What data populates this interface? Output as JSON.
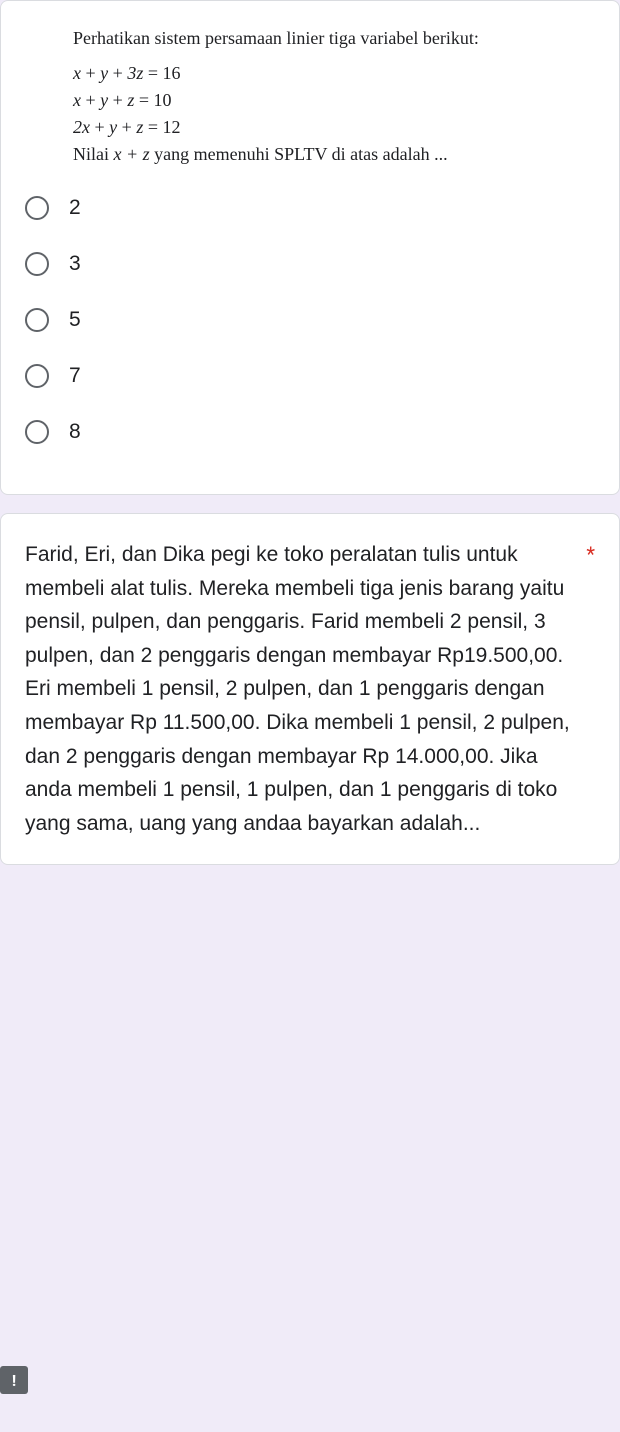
{
  "q1": {
    "intro": "Perhatikan sistem persamaan linier tiga variabel berikut:",
    "eq1_lhs_x": "x",
    "eq1_lhs_y": "y",
    "eq1_lhs_z": "3z",
    "eq1_rhs": "16",
    "eq2_lhs_x": "x",
    "eq2_lhs_y": "y",
    "eq2_lhs_z": "z",
    "eq2_rhs": "10",
    "eq3_lhs_x": "2x",
    "eq3_lhs_y": "y",
    "eq3_lhs_z": "z",
    "eq3_rhs": "12",
    "tail_pre": "Nilai ",
    "tail_var": "x + z",
    "tail_post": " yang memenuhi SPLTV di atas adalah ...",
    "options": [
      "2",
      "3",
      "5",
      "7",
      "8"
    ]
  },
  "q2": {
    "text": "Farid, Eri, dan Dika pegi ke toko peralatan tulis untuk membeli alat tulis. Mereka membeli tiga jenis barang yaitu pensil, pulpen, dan penggaris. Farid membeli 2 pensil, 3 pulpen, dan 2 penggaris dengan membayar Rp19.500,00. Eri membeli 1 pensil, 2 pulpen, dan 1 penggaris dengan membayar Rp 11.500,00. Dika membeli 1 pensil, 2 pulpen, dan 2 penggaris dengan membayar Rp 14.000,00. Jika anda membeli 1 pensil, 1 pulpen, dan 1 penggaris di toko yang sama, uang yang andaa bayarkan adalah...",
    "required_marker": "*"
  },
  "badge": "!"
}
